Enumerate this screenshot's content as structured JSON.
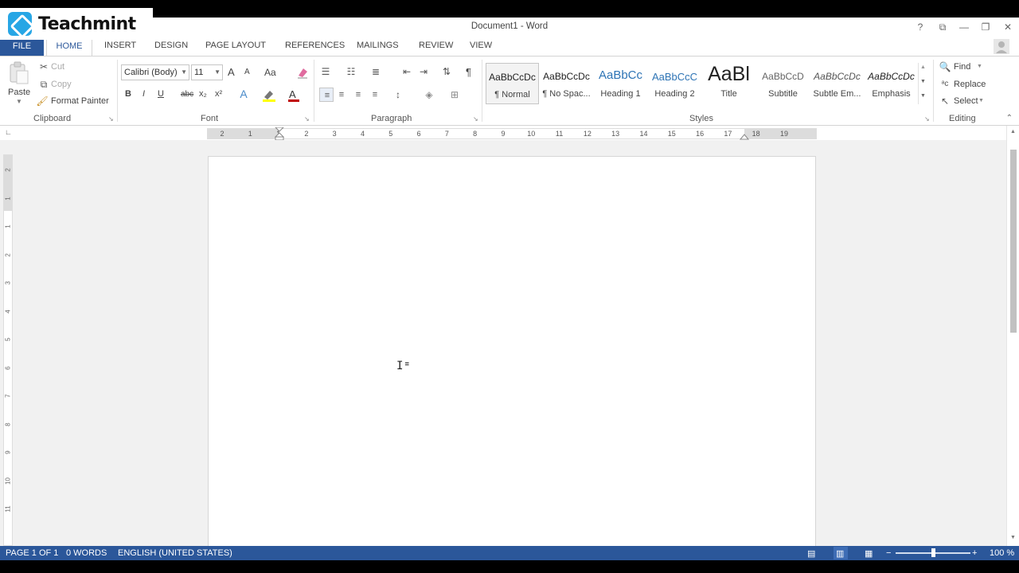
{
  "window": {
    "title": "Document1 - Word",
    "controls": {
      "help": "?",
      "ribbon_options": "⧉",
      "minimize": "—",
      "restore": "❐",
      "close": "✕"
    }
  },
  "watermark": {
    "brand": "Teachmint"
  },
  "tabs": {
    "file": "FILE",
    "home": "HOME",
    "insert": "INSERT",
    "design": "DESIGN",
    "page_layout": "PAGE LAYOUT",
    "references": "REFERENCES",
    "mailings": "MAILINGS",
    "review": "REVIEW",
    "view": "VIEW"
  },
  "clipboard": {
    "label": "Clipboard",
    "paste": "Paste",
    "cut": "Cut",
    "copy": "Copy",
    "format_painter": "Format Painter"
  },
  "font": {
    "label": "Font",
    "family": "Calibri (Body)",
    "size": "11",
    "bold": "B",
    "italic": "I",
    "underline": "U",
    "strike": "abc",
    "subscript": "x₂",
    "superscript": "x²",
    "grow": "A",
    "shrink": "A",
    "case": "Aa",
    "font_color_accent": "#c00000",
    "highlight_accent": "#ffff00"
  },
  "paragraph": {
    "label": "Paragraph",
    "pilcrow": "¶"
  },
  "styles": {
    "label": "Styles",
    "items": [
      {
        "preview": "AaBbCcDc",
        "name": "¶ Normal"
      },
      {
        "preview": "AaBbCcDc",
        "name": "¶ No Spac..."
      },
      {
        "preview": "AaBbCc",
        "name": "Heading 1"
      },
      {
        "preview": "AaBbCcC",
        "name": "Heading 2"
      },
      {
        "preview": "AaBl",
        "name": "Title"
      },
      {
        "preview": "AaBbCcD",
        "name": "Subtitle"
      },
      {
        "preview": "AaBbCcDc",
        "name": "Subtle Em..."
      },
      {
        "preview": "AaBbCcDc",
        "name": "Emphasis"
      }
    ]
  },
  "editing": {
    "label": "Editing",
    "find": "Find",
    "replace": "Replace",
    "select": "Select"
  },
  "ruler": {
    "numbers": [
      "2",
      "1",
      "1",
      "2",
      "3",
      "4",
      "5",
      "6",
      "7",
      "8",
      "9",
      "10",
      "11",
      "12",
      "13",
      "14",
      "15",
      "16",
      "17",
      "18",
      "19"
    ],
    "vertical_numbers": [
      "2",
      "1",
      "1",
      "2",
      "3",
      "4",
      "5",
      "6",
      "7",
      "8",
      "9",
      "10",
      "11"
    ]
  },
  "status": {
    "page": "PAGE 1 OF 1",
    "words": "0 WORDS",
    "language": "ENGLISH (UNITED STATES)",
    "zoom": "100 %",
    "zoom_level": 1.0
  },
  "colors": {
    "accent": "#2b579a",
    "page": "#ffffff",
    "canvas": "#f1f1f1"
  }
}
